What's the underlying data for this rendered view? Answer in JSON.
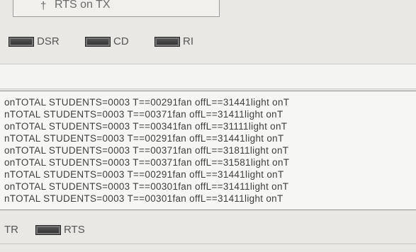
{
  "top_option": {
    "marker": "†",
    "label": "RTS on TX"
  },
  "status_indicators": [
    {
      "label": "DSR"
    },
    {
      "label": "CD"
    },
    {
      "label": "RI"
    }
  ],
  "log_lines": [
    "onTOTAL STUDENTS=0003 T==00291fan offL==31441light onT",
    "nTOTAL STUDENTS=0003 T==00371fan offL==31411light onT",
    "onTOTAL STUDENTS=0003 T==00341fan offL==31111light onT",
    "nTOTAL STUDENTS=0003 T==00291fan offL==31441light onT",
    "onTOTAL STUDENTS=0003 T==00371fan offL==31811light onT",
    "onTOTAL STUDENTS=0003 T==00371fan offL==31581light onT",
    "nTOTAL STUDENTS=0003 T==00291fan offL==31441light onT",
    "onTOTAL STUDENTS=0003 T==00301fan offL==31411light onT",
    "nTOTAL STUDENTS=0003 T==00301fan offL==31411light onT"
  ],
  "bottom_indicators": {
    "partial_label": "TR",
    "rts_label": "RTS"
  }
}
